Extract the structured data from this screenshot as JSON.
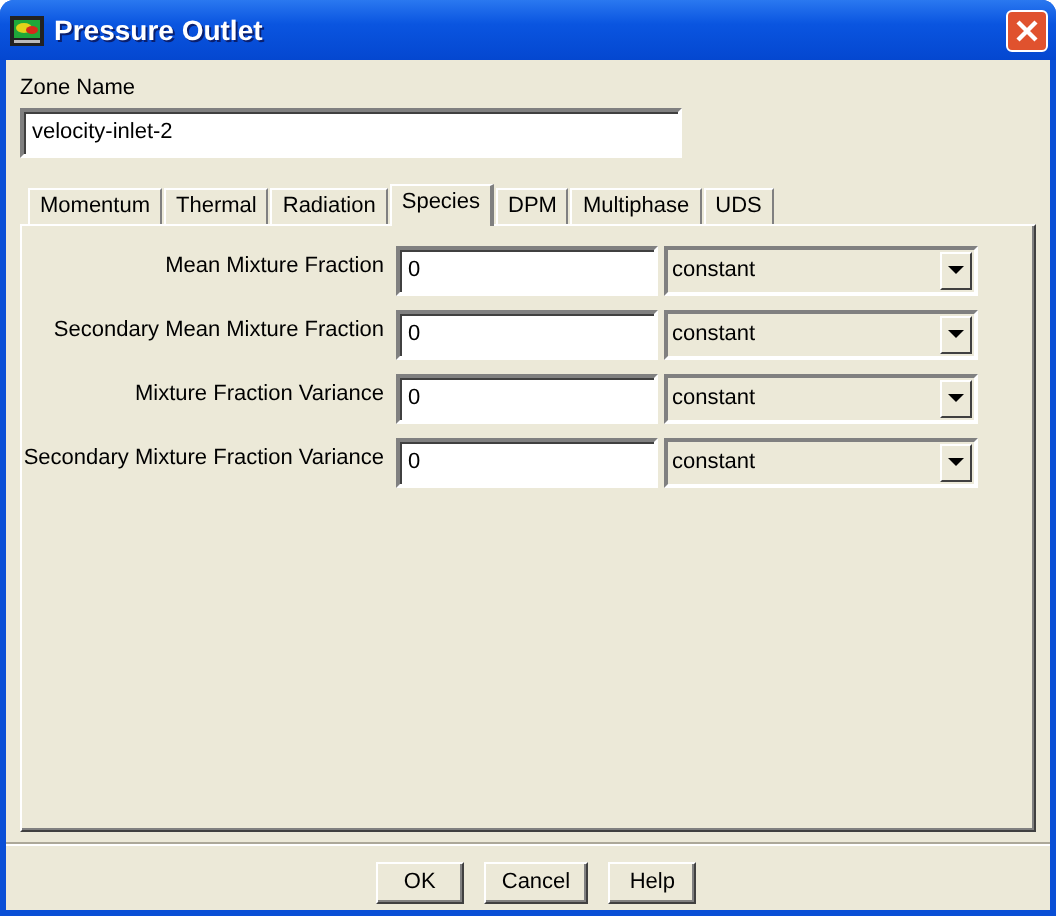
{
  "window": {
    "title": "Pressure Outlet"
  },
  "zone_name": {
    "label": "Zone Name",
    "value": "velocity-inlet-2"
  },
  "tabs": [
    {
      "label": "Momentum",
      "selected": false
    },
    {
      "label": "Thermal",
      "selected": false
    },
    {
      "label": "Radiation",
      "selected": false
    },
    {
      "label": "Species",
      "selected": true
    },
    {
      "label": "DPM",
      "selected": false
    },
    {
      "label": "Multiphase",
      "selected": false
    },
    {
      "label": "UDS",
      "selected": false
    }
  ],
  "fields": [
    {
      "label": "Mean Mixture Fraction",
      "value": "0",
      "method": "constant"
    },
    {
      "label": "Secondary Mean Mixture Fraction",
      "value": "0",
      "method": "constant"
    },
    {
      "label": "Mixture Fraction Variance",
      "value": "0",
      "method": "constant"
    },
    {
      "label": "Secondary Mixture Fraction Variance",
      "value": "0",
      "method": "constant"
    }
  ],
  "buttons": [
    "OK",
    "Cancel",
    "Help"
  ]
}
